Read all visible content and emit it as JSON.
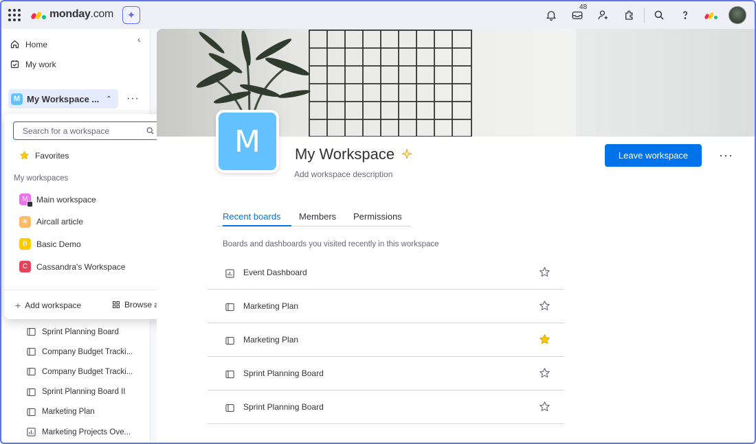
{
  "app": {
    "logo_brand": "monday",
    "logo_domain": ".com",
    "ai_icon": "sparkle-icon",
    "notifications_count": "48"
  },
  "topbar_icons": [
    "bell-icon",
    "inbox-icon",
    "invite-members-icon",
    "apps-icon",
    "search-icon",
    "help-icon",
    "monday-logo-icon",
    "user-avatar"
  ],
  "sidebar": {
    "home_label": "Home",
    "mywork_label": "My work",
    "workspace_label": "My Workspace ...",
    "workspace_initial": "M",
    "boards": [
      {
        "label": "Sprint Planning Board",
        "icon": "board-icon"
      },
      {
        "label": "Company Budget Tracki...",
        "icon": "board-icon"
      },
      {
        "label": "Company Budget Tracki...",
        "icon": "board-icon"
      },
      {
        "label": "Sprint Planning Board II",
        "icon": "board-icon"
      },
      {
        "label": "Marketing Plan",
        "icon": "board-icon"
      },
      {
        "label": "Marketing Projects Ove...",
        "icon": "dashboard-icon"
      }
    ]
  },
  "dropdown": {
    "search_placeholder": "Search for a workspace",
    "favorites_label": "Favorites",
    "section_label": "My workspaces",
    "workspaces": [
      {
        "label": "Main workspace",
        "initial": "M",
        "color": "#e774ea"
      },
      {
        "label": "Aircall article",
        "initial": "✳",
        "color": "#fdbc64"
      },
      {
        "label": "Basic Demo",
        "initial": "B",
        "color": "#ffcb00"
      },
      {
        "label": "Cassandra's Workspace",
        "initial": "C",
        "color": "#e2445c"
      }
    ],
    "add_label": "Add workspace",
    "browse_label": "Browse all"
  },
  "main": {
    "workspace_initial": "M",
    "title": "My Workspace",
    "description_placeholder": "Add workspace description",
    "leave_button": "Leave workspace",
    "tabs": [
      "Recent boards",
      "Members",
      "Permissions"
    ],
    "active_tab": "Recent boards",
    "recent_description": "Boards and dashboards you visited recently in this workspace",
    "recent_boards": [
      {
        "name": "Event Dashboard",
        "icon": "dashboard-icon",
        "favorited": false
      },
      {
        "name": "Marketing Plan",
        "icon": "board-icon",
        "favorited": false
      },
      {
        "name": "Marketing Plan",
        "icon": "board-icon",
        "favorited": true
      },
      {
        "name": "Sprint Planning Board",
        "icon": "board-icon",
        "favorited": false
      },
      {
        "name": "Sprint Planning Board",
        "icon": "board-icon",
        "favorited": false
      }
    ]
  },
  "colors": {
    "accent": "#0073ea",
    "workspace_badge": "#64c1ff",
    "favorite_star": "#ffcb00"
  }
}
